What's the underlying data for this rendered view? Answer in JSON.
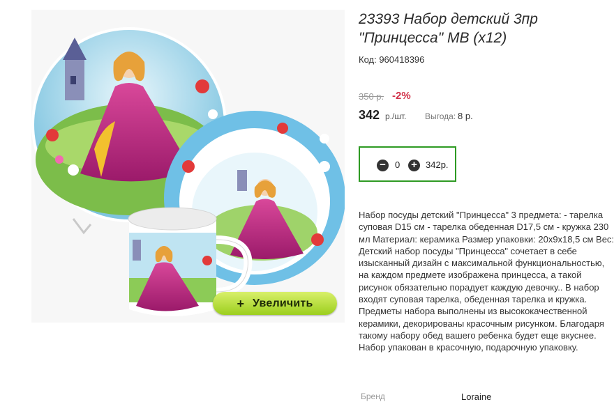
{
  "product": {
    "title": "23393 Набор детский 3пр \"Принцесса\" МВ (x12)",
    "code": "Код: 960418396",
    "image": {
      "zoom_plus": "+",
      "zoom_label": "Увеличить"
    },
    "price": {
      "old": "350 р.",
      "discount": "-2%",
      "current": "342",
      "unit": "р./шт.",
      "benefit_label": "Выгода:",
      "benefit_value": "8 р."
    },
    "quantity": {
      "minus": "−",
      "value": "0",
      "plus": "+",
      "sum": "342р."
    },
    "description": "Набор посуды детский \"Принцесса\" 3 предмета: - тарелка суповая D15 см - тарелка обеденная D17,5 см - кружка 230 мл Материал: керамика Размер упаковки: 20х9х18,5 см Вес: Детский набор посуды \"Принцесса\" сочетает в себе изысканный дизайн с максимальной функциональностью, на каждом предмете изображена принцесса, а такой рисунок обязательно порадует каждую девочку.. В набор входят суповая тарелка, обеденная тарелка и кружка. Предметы набора выполнены из высококачественной керамики, декорированы красочным рисунком. Благодаря такому набору обед вашего ребенка будет еще вкуснее. Набор упакован в красочную, подарочную упаковку.",
    "brand": {
      "label": "Бренд",
      "value": "Loraine"
    }
  },
  "colors": {
    "accent_green": "#2e9a23",
    "discount_red": "#d2334b",
    "zoom_button": "#b6dd3a"
  }
}
